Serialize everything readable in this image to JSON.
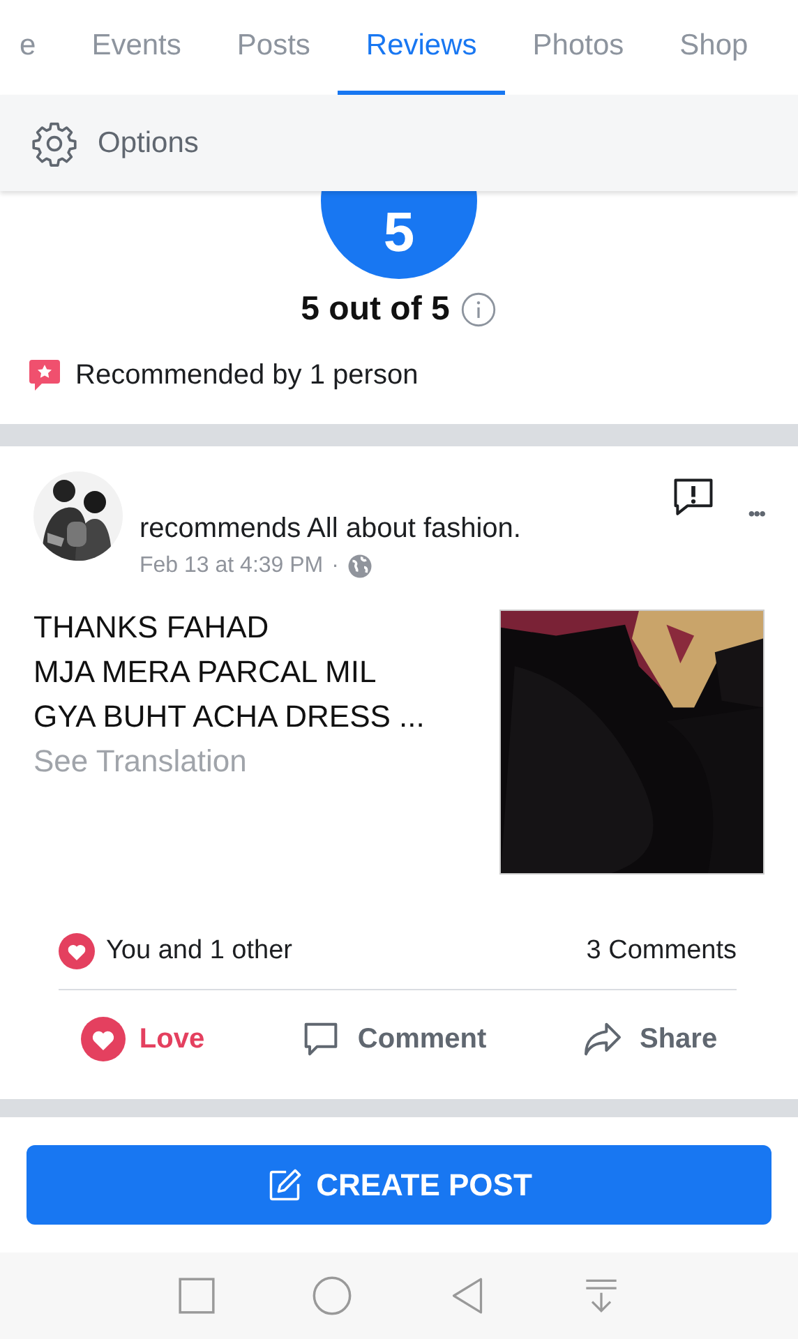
{
  "tabs": [
    {
      "label": "e",
      "selected": false
    },
    {
      "label": "Events",
      "selected": false
    },
    {
      "label": "Posts",
      "selected": false
    },
    {
      "label": "Reviews",
      "selected": true
    },
    {
      "label": "Photos",
      "selected": false
    },
    {
      "label": "Shop",
      "selected": false
    }
  ],
  "options": {
    "label": "Options"
  },
  "rating": {
    "score": "5",
    "summary": "5 out of 5",
    "recommended": "Recommended by 1 person"
  },
  "review": {
    "text": "recommends All about fashion.",
    "time": "Feb 13 at 4:39 PM",
    "separator": "·",
    "lines": [
      "THANKS FAHAD",
      "MJA MERA PARCAL MIL",
      "GYA BUHT ACHA DRESS ..."
    ],
    "translation": "See Translation",
    "more": "•••",
    "reactions": "You and 1 other",
    "comments": "3 Comments",
    "actions": [
      {
        "kind": "love",
        "label": "Love",
        "selected": true
      },
      {
        "kind": "comment",
        "label": "Comment",
        "selected": false
      },
      {
        "kind": "share",
        "label": "Share",
        "selected": false
      }
    ]
  },
  "create_post": {
    "label": "CREATE POST"
  }
}
